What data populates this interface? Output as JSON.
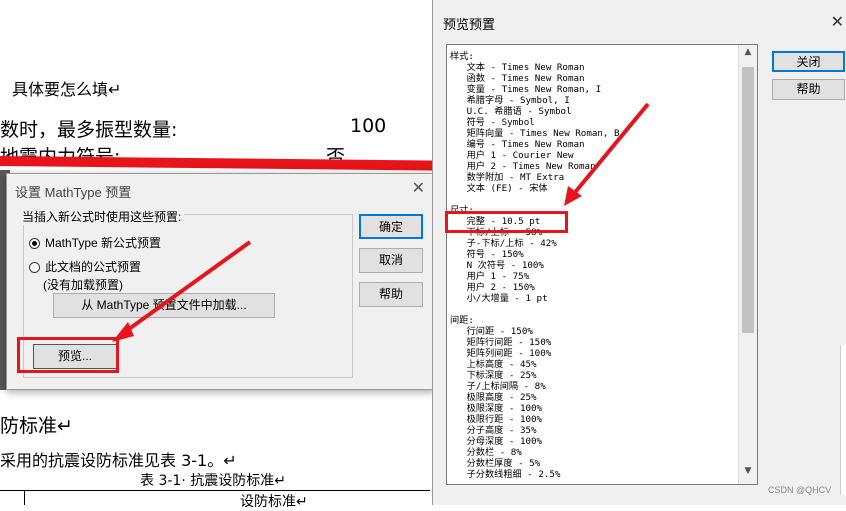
{
  "document": {
    "question": "具体要怎么填↵",
    "line1_label": "数时，最多振型数量:",
    "line1_value": "100",
    "line2_label": "地震内力符号:",
    "line2_value": "否",
    "section_heading": "防标准↵",
    "paragraph": "采用的抗震设防标准见表 3-1。↵",
    "table_caption": "表 3-1· 抗震设防标准↵",
    "table_cell": "设防标准↵"
  },
  "dialog_settings": {
    "title": "设置 MathType 预置",
    "close_glyph": "✕",
    "group_title": "当插入新公式时使用这些预置:",
    "radio_new": "MathType 新公式预置",
    "radio_doc": "此文档的公式预置",
    "radio_doc_note": "(没有加载预置)",
    "load_button": "从 MathType 预置文件中加载...",
    "preview_button": "预览...",
    "ok_button": "确定",
    "cancel_button": "取消",
    "help_button": "帮助"
  },
  "dialog_preview": {
    "title": "预览预置",
    "close_glyph": "✕",
    "close_button": "关闭",
    "help_button": "帮助",
    "preview_text": "样式:\n   文本 - Times New Roman\n   函数 - Times New Roman\n   变量 - Times New Roman, I\n   希腊字母 - Symbol, I\n   U.C. 希腊语 - Symbol\n   符号 - Symbol\n   矩阵向量 - Times New Roman, B\n   编号 - Times New Roman\n   用户 1 - Courier New\n   用户 2 - Times New Roman\n   数学附加 - MT Extra\n   文本 (FE) - 宋体\n\n尺寸:\n   完整 - 10.5 pt\n   下标/上标 - 58%\n   子-下标/上标 - 42%\n   符号 - 150%\n   N 次符号 - 100%\n   用户 1 - 75%\n   用户 2 - 150%\n   小/大增量 - 1 pt\n\n间距:\n   行间距 - 150%\n   矩阵行间距 - 150%\n   矩阵列间距 - 100%\n   上标高度 - 45%\n   下标深度 - 25%\n   子/上标间隔 - 8%\n   极限高度 - 25%\n   极限深度 - 100%\n   极限行距 - 100%\n   分子高度 - 35%\n   分母深度 - 100%\n   分数栏 - 8%\n   分数栏厚度 - 5%\n   子分数线粗细 - 2.5%"
  },
  "watermark": "CSDN @QHCV",
  "colors": {
    "annotation": "#e8141b",
    "focus": "#0078d7"
  }
}
